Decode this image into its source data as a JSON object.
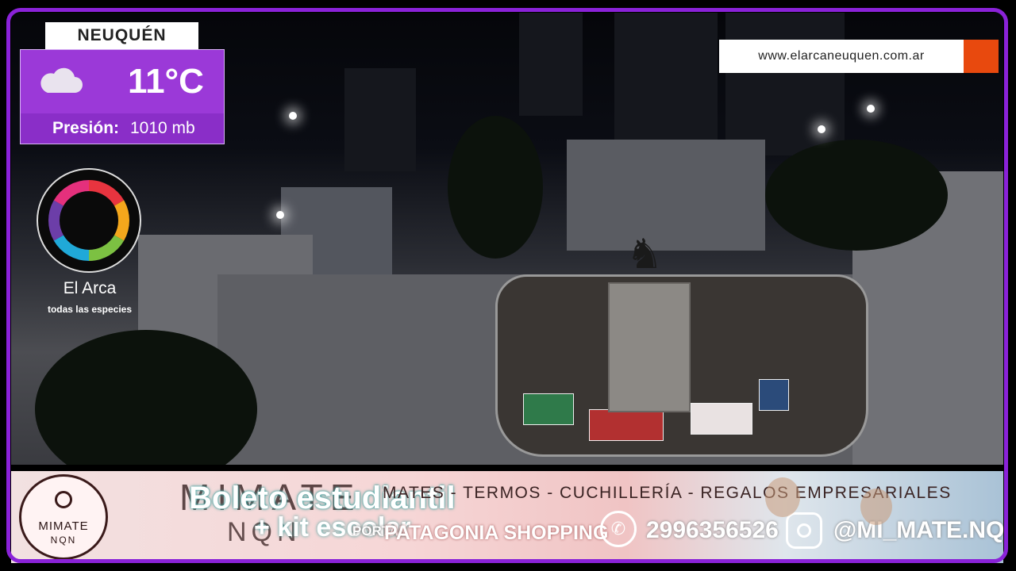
{
  "weather": {
    "city": "NEUQUÉN",
    "temperature": "11°C",
    "pressure_label": "Presión:",
    "pressure_value": "1010 mb",
    "icon": "cloud-icon"
  },
  "channel": {
    "logo_icon": "el-arca-logo",
    "name": "El Arca",
    "tagline": "todas las especies",
    "url": "www.elarcaneuquen.com.ar"
  },
  "ad": {
    "brand_logo_text": "MIMATE",
    "brand_logo_sub": "NQN",
    "brand_big": "MIMATE",
    "brand_big_sub": "NQN",
    "promo_line1": "Boleto estudiantil",
    "promo_line2": "+ kit escolar",
    "portal_text": "PORTAL",
    "items": "MATES - TERMOS - CUCHILLERÍA - REGALOS EMPRESARIALES",
    "mall": "PATAGONIA SHOPPING",
    "phone": "2996356526",
    "instagram": "@MI_MATE.NQN",
    "icons": [
      "whatsapp-icon",
      "instagram-icon"
    ]
  },
  "colors": {
    "frame": "#8a22d8",
    "weather_panel": "#9b39d8",
    "url_accent": "#e8490e"
  }
}
